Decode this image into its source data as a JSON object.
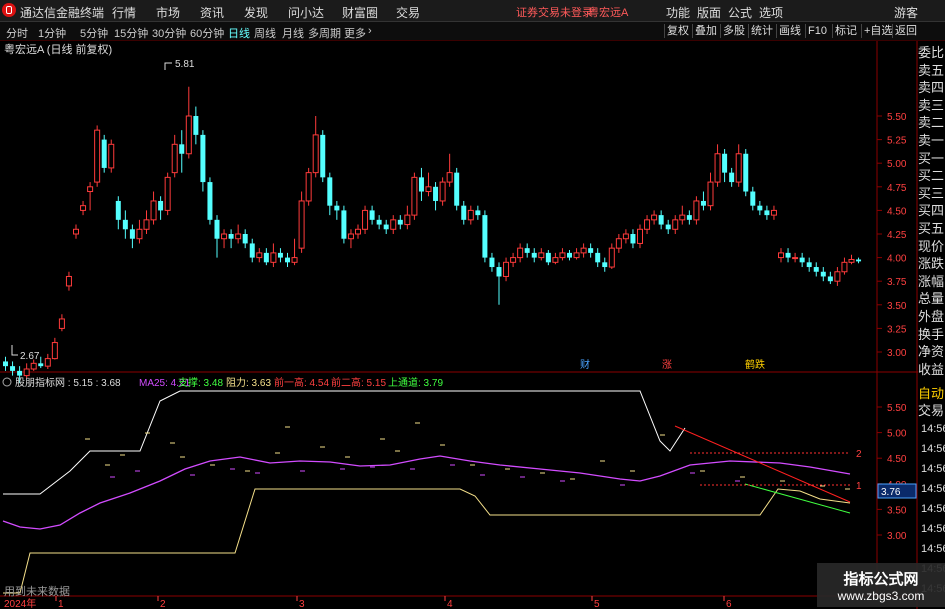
{
  "menubar": {
    "app_title": "通达信金融终端",
    "items": [
      "行情",
      "市场",
      "资讯",
      "发现",
      "问小达",
      "财富圈",
      "交易"
    ],
    "login_status": "证券交易未登录",
    "stock_name": "粤宏远A",
    "right_items": [
      "功能",
      "版面",
      "公式",
      "选项",
      "游客"
    ]
  },
  "periodbar": {
    "periods": [
      "分时",
      "1分钟",
      "5分钟",
      "15分钟",
      "30分钟",
      "60分钟",
      "日线",
      "周线",
      "月线",
      "多周期",
      "更多"
    ],
    "active": "日线",
    "tools": [
      "复权",
      "叠加",
      "多股",
      "统计",
      "画线",
      "F10",
      "标记",
      "+自选",
      "返回"
    ]
  },
  "main_chart": {
    "title": "粤宏远A (日线 前复权)",
    "y_ticks": [
      "5.50",
      "5.25",
      "5.00",
      "4.75",
      "4.50",
      "4.25",
      "4.00",
      "3.75",
      "3.50",
      "3.25",
      "3.00"
    ],
    "high_label": "5.81",
    "low_label": "2.67",
    "event_markers": [
      {
        "label": "财",
        "color": "#4aa3ff"
      },
      {
        "label": "涨",
        "color": "#ff4040"
      },
      {
        "label": "鹤跌",
        "color": "#ffd000"
      }
    ]
  },
  "indicator": {
    "name": "股朋指标网 : 5.15 : 3.68",
    "ma25": "MA25: 4.21",
    "support": "支撑: 3.48",
    "resistance": "阻力: 3.63",
    "prev_high1": "前一高: 4.54",
    "prev_high2": "前二高: 5.15",
    "upper_channel": "上通道: 3.79",
    "y_ticks": [
      "5.50",
      "5.00",
      "4.50",
      "4.00",
      "3.50",
      "3.00"
    ],
    "current_value": "3.76",
    "line_labels": [
      "2",
      "1"
    ],
    "note": "用到未来数据",
    "colors": {
      "white": "#ffffff",
      "magenta": "#d24cff",
      "yellow": "#f5e08a",
      "red": "#ff2020",
      "green": "#40ff40"
    }
  },
  "x_axis": {
    "year": "2024年",
    "months": [
      "1",
      "2",
      "3",
      "4",
      "5",
      "6"
    ]
  },
  "right_panel": {
    "labels": [
      "委比",
      "卖五",
      "卖四",
      "卖三",
      "卖二",
      "卖一",
      "买一",
      "买二",
      "买三",
      "买四",
      "买五",
      "现价",
      "涨跌",
      "涨幅",
      "总量",
      "外盘",
      "换手",
      "净资",
      "收益"
    ],
    "tab_labels": [
      "自动",
      "交易"
    ],
    "times": [
      "14:56",
      "14:56",
      "14:56",
      "14:56",
      "14:56",
      "14:56",
      "14:56",
      "14:56",
      "14:56"
    ]
  },
  "watermark": {
    "line1": "指标公式网",
    "line2": "www.zbgs3.com"
  },
  "chart_data": {
    "type": "candlestick",
    "title": "粤宏远A (日线 前复权)",
    "ylim": [
      2.6,
      5.95
    ],
    "candles": [
      [
        2.9,
        2.85,
        2.95,
        2.8
      ],
      [
        2.85,
        2.8,
        2.9,
        2.75
      ],
      [
        2.8,
        2.75,
        2.85,
        2.67
      ],
      [
        2.75,
        2.82,
        2.88,
        2.72
      ],
      [
        2.82,
        2.88,
        2.92,
        2.8
      ],
      [
        2.88,
        2.85,
        2.95,
        2.83
      ],
      [
        2.85,
        2.93,
        2.98,
        2.82
      ],
      [
        2.93,
        3.1,
        3.15,
        2.92
      ],
      [
        3.25,
        3.35,
        3.4,
        3.22
      ],
      [
        3.7,
        3.8,
        3.85,
        3.65
      ],
      [
        4.25,
        4.3,
        4.35,
        4.2
      ],
      [
        4.5,
        4.55,
        4.6,
        4.45
      ],
      [
        4.7,
        4.75,
        4.8,
        4.5
      ],
      [
        4.8,
        5.35,
        5.4,
        4.75
      ],
      [
        5.25,
        4.95,
        5.3,
        4.9
      ],
      [
        4.95,
        5.2,
        5.25,
        4.9
      ],
      [
        4.6,
        4.4,
        4.65,
        4.3
      ],
      [
        4.4,
        4.3,
        4.5,
        4.2
      ],
      [
        4.3,
        4.2,
        4.35,
        4.1
      ],
      [
        4.2,
        4.3,
        4.4,
        4.15
      ],
      [
        4.3,
        4.4,
        4.5,
        4.25
      ],
      [
        4.4,
        4.6,
        4.7,
        4.35
      ],
      [
        4.6,
        4.5,
        4.65,
        4.4
      ],
      [
        4.5,
        4.85,
        4.9,
        4.45
      ],
      [
        4.9,
        5.2,
        5.3,
        4.85
      ],
      [
        5.2,
        5.1,
        5.35,
        4.9
      ],
      [
        5.1,
        5.5,
        5.81,
        5.05
      ],
      [
        5.5,
        5.3,
        5.6,
        5.2
      ],
      [
        5.3,
        4.8,
        5.35,
        4.7
      ],
      [
        4.8,
        4.4,
        4.85,
        4.35
      ],
      [
        4.4,
        4.2,
        4.45,
        4.0
      ],
      [
        4.2,
        4.25,
        4.3,
        4.1
      ],
      [
        4.25,
        4.2,
        4.3,
        4.1
      ],
      [
        4.2,
        4.25,
        4.35,
        4.15
      ],
      [
        4.25,
        4.15,
        4.3,
        4.1
      ],
      [
        4.15,
        4.0,
        4.2,
        3.95
      ],
      [
        4.0,
        4.05,
        4.1,
        3.95
      ],
      [
        4.05,
        3.95,
        4.1,
        3.92
      ],
      [
        3.95,
        4.05,
        4.15,
        3.9
      ],
      [
        4.05,
        4.0,
        4.1,
        3.95
      ],
      [
        4.0,
        3.95,
        4.05,
        3.9
      ],
      [
        3.95,
        4.0,
        4.2,
        3.92
      ],
      [
        4.1,
        4.6,
        4.7,
        4.05
      ],
      [
        4.6,
        4.9,
        4.95,
        4.55
      ],
      [
        4.9,
        5.3,
        5.5,
        4.85
      ],
      [
        5.3,
        4.85,
        5.35,
        4.8
      ],
      [
        4.85,
        4.55,
        4.9,
        4.45
      ],
      [
        4.55,
        4.5,
        4.6,
        4.4
      ],
      [
        4.5,
        4.2,
        4.55,
        4.15
      ],
      [
        4.2,
        4.25,
        4.3,
        4.1
      ],
      [
        4.25,
        4.3,
        4.35,
        4.2
      ],
      [
        4.3,
        4.5,
        4.55,
        4.25
      ],
      [
        4.5,
        4.4,
        4.55,
        4.35
      ],
      [
        4.4,
        4.35,
        4.45,
        4.3
      ],
      [
        4.35,
        4.3,
        4.4,
        4.25
      ],
      [
        4.3,
        4.4,
        4.45,
        4.25
      ],
      [
        4.4,
        4.35,
        4.45,
        4.3
      ],
      [
        4.35,
        4.45,
        4.55,
        4.3
      ],
      [
        4.45,
        4.85,
        4.9,
        4.4
      ],
      [
        4.85,
        4.7,
        4.95,
        4.6
      ],
      [
        4.7,
        4.75,
        4.9,
        4.65
      ],
      [
        4.75,
        4.6,
        4.8,
        4.5
      ],
      [
        4.6,
        4.8,
        4.85,
        4.55
      ],
      [
        4.8,
        4.9,
        5.1,
        4.75
      ],
      [
        4.9,
        4.55,
        4.95,
        4.5
      ],
      [
        4.55,
        4.4,
        4.6,
        4.35
      ],
      [
        4.4,
        4.5,
        4.55,
        4.35
      ],
      [
        4.5,
        4.45,
        4.55,
        4.4
      ],
      [
        4.45,
        4.0,
        4.5,
        3.95
      ],
      [
        4.0,
        3.9,
        4.05,
        3.85
      ],
      [
        3.9,
        3.8,
        3.95,
        3.5
      ],
      [
        3.8,
        3.95,
        4.0,
        3.75
      ],
      [
        3.95,
        4.0,
        4.05,
        3.9
      ],
      [
        4.0,
        4.1,
        4.15,
        3.95
      ],
      [
        4.1,
        4.05,
        4.15,
        4.0
      ],
      [
        4.05,
        4.0,
        4.1,
        3.95
      ],
      [
        4.0,
        4.05,
        4.1,
        3.97
      ],
      [
        4.05,
        3.95,
        4.08,
        3.92
      ],
      [
        3.95,
        4.0,
        4.05,
        3.93
      ],
      [
        4.0,
        4.05,
        4.1,
        3.97
      ],
      [
        4.05,
        4.0,
        4.08,
        3.97
      ],
      [
        4.0,
        4.05,
        4.1,
        3.98
      ],
      [
        4.05,
        4.1,
        4.15,
        4.0
      ],
      [
        4.1,
        4.05,
        4.15,
        4.0
      ],
      [
        4.05,
        3.95,
        4.1,
        3.9
      ],
      [
        3.95,
        3.9,
        4.0,
        3.85
      ],
      [
        3.9,
        4.1,
        4.15,
        3.88
      ],
      [
        4.1,
        4.2,
        4.25,
        4.05
      ],
      [
        4.2,
        4.25,
        4.3,
        4.15
      ],
      [
        4.25,
        4.15,
        4.3,
        4.1
      ],
      [
        4.15,
        4.3,
        4.35,
        4.1
      ],
      [
        4.3,
        4.4,
        4.45,
        4.25
      ],
      [
        4.4,
        4.45,
        4.5,
        4.35
      ],
      [
        4.45,
        4.35,
        4.5,
        4.3
      ],
      [
        4.35,
        4.3,
        4.4,
        4.25
      ],
      [
        4.3,
        4.4,
        4.45,
        4.25
      ],
      [
        4.4,
        4.45,
        4.55,
        4.35
      ],
      [
        4.45,
        4.4,
        4.5,
        4.35
      ],
      [
        4.4,
        4.6,
        4.65,
        4.35
      ],
      [
        4.6,
        4.55,
        4.7,
        4.5
      ],
      [
        4.55,
        4.8,
        4.9,
        4.5
      ],
      [
        4.8,
        5.1,
        5.2,
        4.75
      ],
      [
        5.1,
        4.9,
        5.15,
        4.8
      ],
      [
        4.9,
        4.8,
        4.95,
        4.75
      ],
      [
        4.8,
        5.1,
        5.2,
        4.75
      ],
      [
        5.1,
        4.7,
        5.15,
        4.65
      ],
      [
        4.7,
        4.55,
        4.75,
        4.5
      ],
      [
        4.55,
        4.5,
        4.6,
        4.45
      ],
      [
        4.5,
        4.45,
        4.55,
        4.4
      ],
      [
        4.45,
        4.5,
        4.55,
        4.4
      ],
      [
        4.0,
        4.05,
        4.1,
        3.95
      ],
      [
        4.05,
        4.0,
        4.1,
        3.95
      ],
      [
        4.0,
        4.0,
        4.05,
        3.95
      ],
      [
        4.0,
        3.95,
        4.05,
        3.9
      ],
      [
        3.95,
        3.9,
        4.0,
        3.85
      ],
      [
        3.9,
        3.85,
        3.95,
        3.8
      ],
      [
        3.85,
        3.8,
        3.9,
        3.75
      ],
      [
        3.8,
        3.75,
        3.85,
        3.72
      ],
      [
        3.75,
        3.85,
        3.9,
        3.7
      ],
      [
        3.85,
        3.95,
        4.0,
        3.82
      ],
      [
        3.95,
        3.98,
        4.03,
        3.93
      ],
      [
        3.98,
        3.96,
        4.0,
        3.94
      ]
    ],
    "x_labels": [
      "2024年",
      "1",
      "2",
      "3",
      "4",
      "5",
      "6"
    ]
  }
}
